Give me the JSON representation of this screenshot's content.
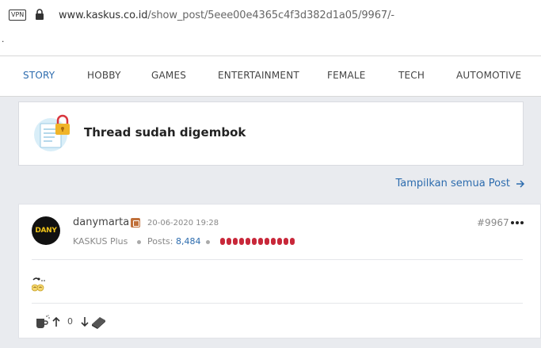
{
  "browser": {
    "vpn_label": "VPN",
    "url_domain": "www.kaskus.co.id",
    "url_path": "/show_post/5eee00e4365c4f3d382d1a05/9967/-",
    "stray_text": "."
  },
  "nav": {
    "items": [
      {
        "label": "STORY",
        "active": true
      },
      {
        "label": "HOBBY"
      },
      {
        "label": "GAMES"
      },
      {
        "label": "ENTERTAINMENT"
      },
      {
        "label": "FEMALE"
      },
      {
        "label": "TECH"
      },
      {
        "label": "AUTOMOTIVE"
      }
    ]
  },
  "locked": {
    "message": "Thread sudah digembok"
  },
  "show_all": {
    "label": "Tampilkan semua Post"
  },
  "post": {
    "avatar_text": "DANY",
    "username": "danymarta",
    "date": "20-06-2020 19:28",
    "rank": "KASKUS Plus",
    "posts_label": "Posts:",
    "posts_count": "8,484",
    "reputation_level": 12,
    "post_number": "#9967",
    "vote_count": "0"
  },
  "colors": {
    "accent": "#2d6cae",
    "reputation": "#c8283a",
    "lock": "#f0b429"
  }
}
